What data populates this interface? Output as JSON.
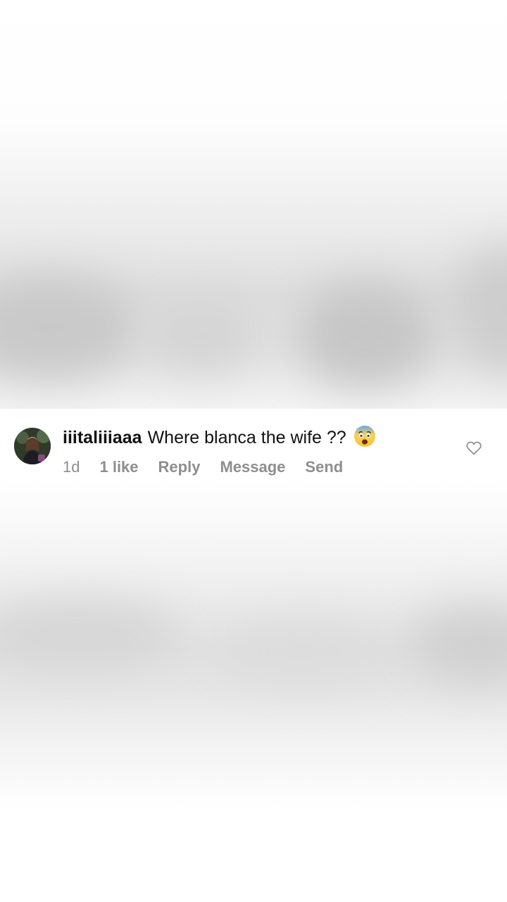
{
  "comment": {
    "username": "iiitaliiiaaa",
    "text": "Where blanca the wife ??",
    "emoji": "face-with-open-mouth-and-cold-sweat",
    "time": "1d",
    "likes": "1 like",
    "reply_label": "Reply",
    "message_label": "Message",
    "send_label": "Send"
  },
  "icons": {
    "avatar": "user-avatar",
    "like": "heart-outline-icon"
  },
  "colors": {
    "username": "#111111",
    "meta": "#8e8e8e",
    "background_card": "#ffffff"
  }
}
